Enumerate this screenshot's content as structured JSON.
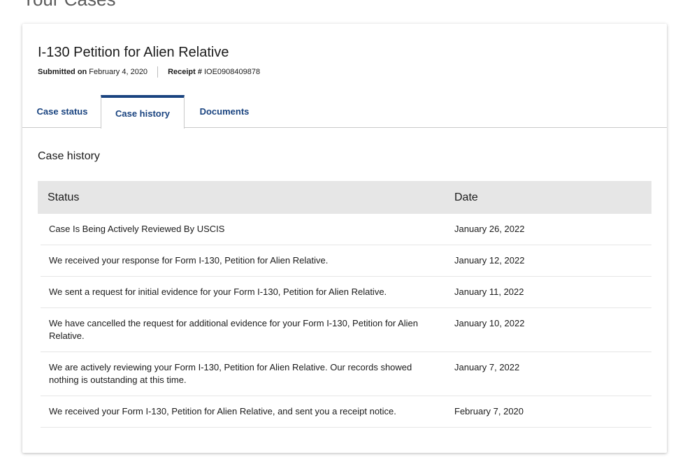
{
  "page": {
    "heading": "Your Cases"
  },
  "case": {
    "title": "I-130 Petition for Alien Relative",
    "submitted_label": "Submitted on",
    "submitted_value": "February 4, 2020",
    "receipt_label": "Receipt #",
    "receipt_value": "IOE0908409878"
  },
  "tabs": [
    {
      "label": "Case status",
      "active": false
    },
    {
      "label": "Case history",
      "active": true
    },
    {
      "label": "Documents",
      "active": false
    }
  ],
  "history": {
    "title": "Case history",
    "columns": [
      "Status",
      "Date"
    ],
    "rows": [
      {
        "status": "Case Is Being Actively Reviewed By USCIS",
        "date": "January 26, 2022"
      },
      {
        "status": "We received your response for Form I-130, Petition for Alien Relative.",
        "date": "January 12, 2022"
      },
      {
        "status": "We sent a request for initial evidence for your Form I-130, Petition for Alien Relative.",
        "date": "January 11, 2022"
      },
      {
        "status": "We have cancelled the request for additional evidence for your Form I-130, Petition for Alien Relative.",
        "date": "January 10, 2022"
      },
      {
        "status": "We are actively reviewing your Form I-130, Petition for Alien Relative. Our records showed nothing is outstanding at this time.",
        "date": "January 7, 2022"
      },
      {
        "status": "We received your Form I-130, Petition for Alien Relative, and sent you a receipt notice.",
        "date": "February 7, 2020"
      }
    ]
  },
  "colors": {
    "accent": "#1a4480",
    "table_header_bg": "#e6e6e6"
  }
}
